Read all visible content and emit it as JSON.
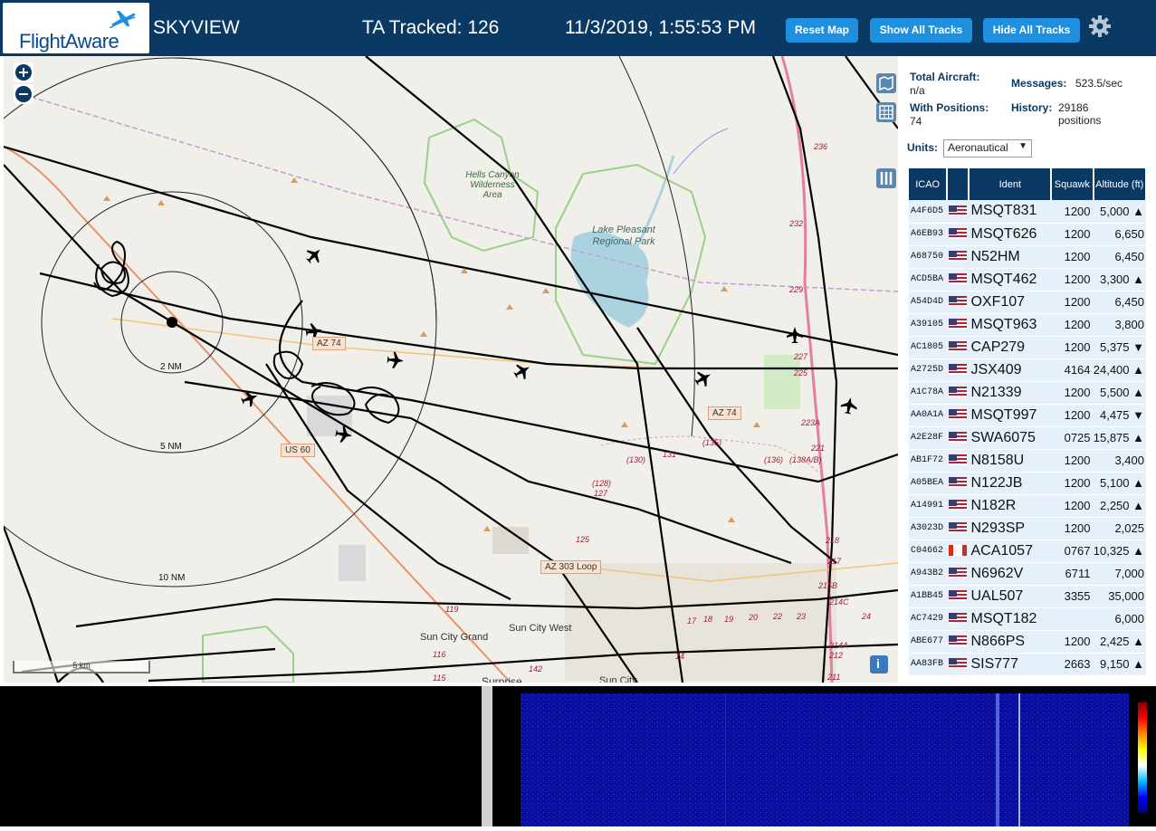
{
  "header": {
    "logo_text": "FlightAware",
    "app_title": "SKYVIEW",
    "tracked": "TA Tracked: 126",
    "datetime": "11/3/2019, 1:55:53 PM",
    "reset_map": "Reset Map",
    "show_all": "Show All Tracks",
    "hide_all": "Hide All Tracks",
    "settings_icon": "gear-icon"
  },
  "map": {
    "labels": {
      "hells_canyon": "Hells Canyon Wilderness Area",
      "lake_pleasant": "Lake Pleasant Regional Park",
      "sun_city_west": "Sun City West",
      "sun_city_grand": "Sun City Grand",
      "surprise": "Surprise",
      "sun_city": "Sun City"
    },
    "rings": [
      "2 NM",
      "5 NM",
      "10 NM"
    ],
    "shields": {
      "az74a": "AZ 74",
      "az74b": "AZ 74",
      "us60": "US 60",
      "az303": "AZ 303 Loop"
    },
    "routes": [
      "(130)",
      "131",
      "(135)",
      "(128)",
      "127",
      "(136)",
      "(138A/B)",
      "125",
      "236",
      "232",
      "229",
      "227",
      "225",
      "223A",
      "221",
      "218",
      "217",
      "215B",
      "214C",
      "214A",
      "212",
      "211",
      "119",
      "116",
      "115",
      "142",
      "14",
      "17",
      "18",
      "19",
      "20",
      "22",
      "23",
      "24"
    ],
    "scale": "5 km",
    "info_icon": "info-icon"
  },
  "sidebar": {
    "total_aircraft_label": "Total Aircraft:",
    "total_aircraft_value": "n/a",
    "with_positions_label": "With Positions:",
    "with_positions_value": "74",
    "messages_label": "Messages:",
    "messages_value": "523.5/sec",
    "history_label": "History:",
    "history_value": "29186 positions",
    "units_label": "Units:",
    "units_value": "Aeronautical",
    "columns": [
      "ICAO",
      "",
      "Ident",
      "Squawk",
      "Altitude (ft)"
    ],
    "rows": [
      {
        "icao": "A4F6D5",
        "flag": "US",
        "ident": "MSQT831",
        "squawk": "1200",
        "alt": "5,000 ▲"
      },
      {
        "icao": "A6EB93",
        "flag": "US",
        "ident": "MSQT626",
        "squawk": "1200",
        "alt": "6,650"
      },
      {
        "icao": "A68750",
        "flag": "US",
        "ident": "N52HM",
        "squawk": "1200",
        "alt": "6,450"
      },
      {
        "icao": "ACD5BA",
        "flag": "US",
        "ident": "MSQT462",
        "squawk": "1200",
        "alt": "3,300 ▲"
      },
      {
        "icao": "A54D4D",
        "flag": "US",
        "ident": "OXF107",
        "squawk": "1200",
        "alt": "6,450"
      },
      {
        "icao": "A39105",
        "flag": "US",
        "ident": "MSQT963",
        "squawk": "1200",
        "alt": "3,800"
      },
      {
        "icao": "AC1805",
        "flag": "US",
        "ident": "CAP279",
        "squawk": "1200",
        "alt": "5,375 ▼"
      },
      {
        "icao": "A2725D",
        "flag": "US",
        "ident": "JSX409",
        "squawk": "4164",
        "alt": "24,400 ▲"
      },
      {
        "icao": "A1C78A",
        "flag": "US",
        "ident": "N21339",
        "squawk": "1200",
        "alt": "5,500 ▲"
      },
      {
        "icao": "AA0A1A",
        "flag": "US",
        "ident": "MSQT997",
        "squawk": "1200",
        "alt": "4,475 ▼"
      },
      {
        "icao": "A2E28F",
        "flag": "US",
        "ident": "SWA6075",
        "squawk": "0725",
        "alt": "15,875 ▲"
      },
      {
        "icao": "AB1F72",
        "flag": "US",
        "ident": "N8158U",
        "squawk": "1200",
        "alt": "3,400"
      },
      {
        "icao": "A05BEA",
        "flag": "US",
        "ident": "N122JB",
        "squawk": "1200",
        "alt": "5,100 ▲"
      },
      {
        "icao": "A14991",
        "flag": "US",
        "ident": "N182R",
        "squawk": "1200",
        "alt": "2,250 ▲"
      },
      {
        "icao": "A3023D",
        "flag": "US",
        "ident": "N293SP",
        "squawk": "1200",
        "alt": "2,025"
      },
      {
        "icao": "C04662",
        "flag": "CA",
        "ident": "ACA1057",
        "squawk": "0767",
        "alt": "10,325 ▲"
      },
      {
        "icao": "A943B2",
        "flag": "US",
        "ident": "N6962V",
        "squawk": "6711",
        "alt": "7,000"
      },
      {
        "icao": "A1BB45",
        "flag": "US",
        "ident": "UAL507",
        "squawk": "3355",
        "alt": "35,000"
      },
      {
        "icao": "AC7429",
        "flag": "US",
        "ident": "MSQT182",
        "squawk": "",
        "alt": "6,000"
      },
      {
        "icao": "ABE677",
        "flag": "US",
        "ident": "N866PS",
        "squawk": "1200",
        "alt": "2,425 ▲"
      },
      {
        "icao": "AA83FB",
        "flag": "US",
        "ident": "SIS777",
        "squawk": "2663",
        "alt": "9,150 ▲"
      }
    ]
  },
  "colors": {
    "header_bg": "#0a3a63",
    "button": "#1f8fe0",
    "row_bg": "#e6f0fa",
    "waterfall": "#0b0e9c"
  }
}
